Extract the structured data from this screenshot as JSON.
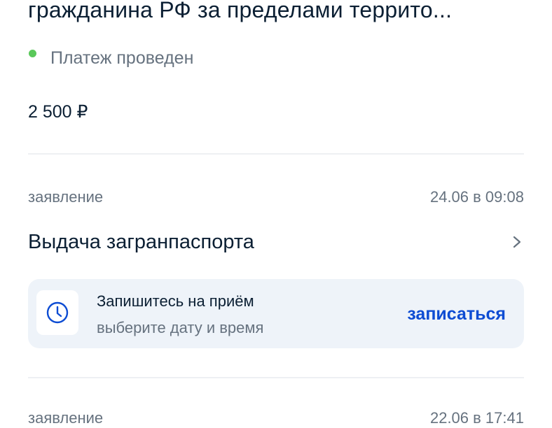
{
  "header": {
    "title": "гражданина РФ за пределами террито..."
  },
  "payment": {
    "status_text": "Платеж проведен",
    "status_color": "#5ac85a",
    "amount": "2 500 ₽"
  },
  "applications": [
    {
      "kind": "заявление",
      "date": "24.06 в 09:08",
      "service": "Выдача загранпаспорта",
      "appointment": {
        "title": "Запишитесь на приём",
        "subtitle": "выберите дату и время",
        "action": "записаться",
        "icon": "clock-icon"
      }
    },
    {
      "kind": "заявление",
      "date": "22.06 в 17:41"
    }
  ],
  "colors": {
    "accent": "#0d4cd3",
    "muted": "#66727f",
    "card_bg": "#eef3f9"
  }
}
